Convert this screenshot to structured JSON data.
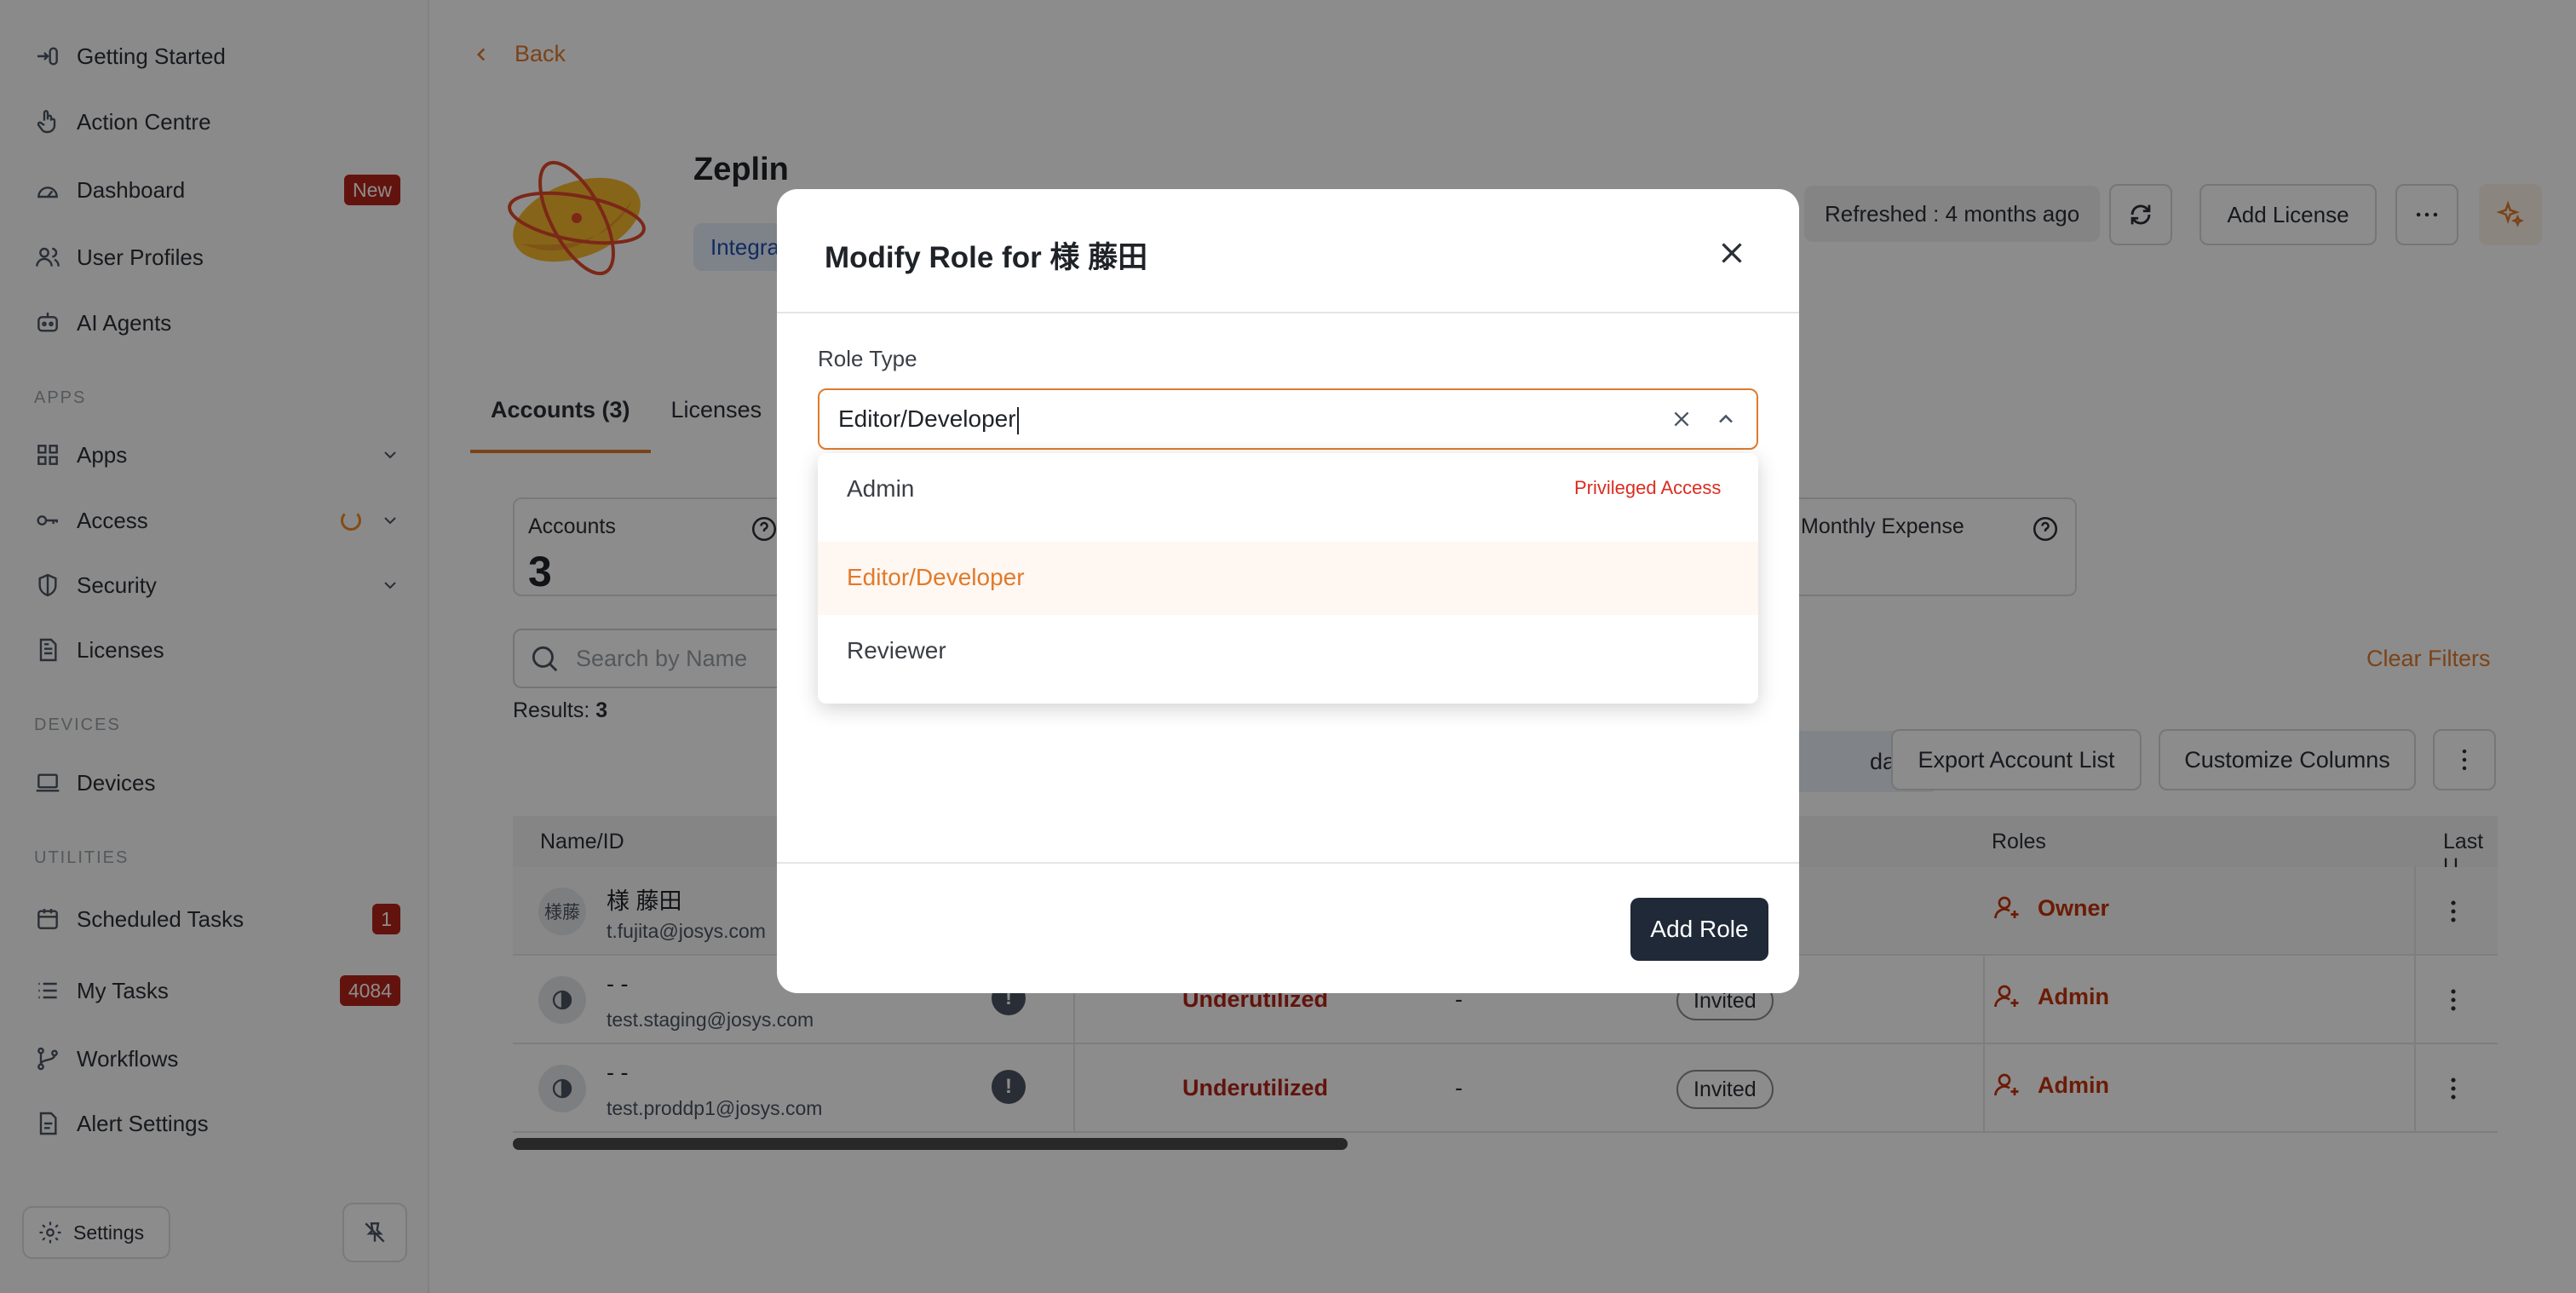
{
  "sidebar": {
    "items_top": [
      {
        "label": "Getting Started",
        "icon": "getting-started-icon"
      },
      {
        "label": "Action Centre",
        "icon": "hand-pointer-icon"
      },
      {
        "label": "Dashboard",
        "icon": "dashboard-gauge-icon",
        "badge": "New"
      },
      {
        "label": "User Profiles",
        "icon": "users-icon"
      },
      {
        "label": "AI Agents",
        "icon": "robot-icon"
      }
    ],
    "section_apps": "APPS",
    "items_apps": [
      {
        "label": "Apps",
        "icon": "grid-icon"
      },
      {
        "label": "Access",
        "icon": "key-icon"
      },
      {
        "label": "Security",
        "icon": "shield-icon"
      },
      {
        "label": "Licenses",
        "icon": "document-icon"
      }
    ],
    "section_devices": "DEVICES",
    "items_devices": [
      {
        "label": "Devices",
        "icon": "laptop-icon"
      }
    ],
    "section_utilities": "UTILITIES",
    "items_utilities": [
      {
        "label": "Scheduled Tasks",
        "icon": "calendar-icon",
        "badge": "1"
      },
      {
        "label": "My Tasks",
        "icon": "list-icon",
        "badge": "4084"
      },
      {
        "label": "Workflows",
        "icon": "branch-icon"
      },
      {
        "label": "Alert Settings",
        "icon": "bell-file-icon"
      }
    ],
    "settings_label": "Settings"
  },
  "header": {
    "back_label": "Back",
    "app_name": "Zeplin",
    "integration_pill": "Integra",
    "refreshed": "Refreshed : 4 months ago",
    "add_license_label": "Add License"
  },
  "tabs": [
    {
      "label": "Accounts (3)",
      "active": true
    },
    {
      "label": "Licenses",
      "active": false
    }
  ],
  "cards": {
    "accounts_label": "Accounts",
    "accounts_value": "3",
    "expense_label": "Monthly Expense"
  },
  "filters": {
    "search_placeholder": "Search by Name",
    "results_prefix": "Results: ",
    "results_count": "3",
    "clear_filters": "Clear Filters",
    "days_label": "days",
    "export_label": "Export Account List",
    "customize_label": "Customize Columns"
  },
  "table": {
    "headers": {
      "name": "Name/ID",
      "roles": "Roles",
      "last": "Last U"
    },
    "rows": [
      {
        "avatar": "様藤",
        "name": "様 藤田",
        "email": "t.fujita@josys.com",
        "status": "",
        "dash": "",
        "state": "",
        "role": "Owner"
      },
      {
        "avatar": "",
        "name": "- -",
        "email": "test.staging@josys.com",
        "status": "Underutilized",
        "dash": "-",
        "state": "Invited",
        "role": "Admin"
      },
      {
        "avatar": "",
        "name": "- -",
        "email": "test.proddp1@josys.com",
        "status": "Underutilized",
        "dash": "-",
        "state": "Invited",
        "role": "Admin"
      }
    ]
  },
  "modal": {
    "title": "Modify Role for 様 藤田",
    "field_label": "Role Type",
    "select_value": "Editor/Developer",
    "options": [
      {
        "label": "Admin",
        "tag": "Privileged Access",
        "selected": false
      },
      {
        "label": "Editor/Developer",
        "tag": "",
        "selected": true
      },
      {
        "label": "Reviewer",
        "tag": "",
        "selected": false
      }
    ],
    "submit_label": "Add Role"
  },
  "colors": {
    "accent": "#e07a2c",
    "danger": "#b42318",
    "dark_button": "#1f2937"
  }
}
